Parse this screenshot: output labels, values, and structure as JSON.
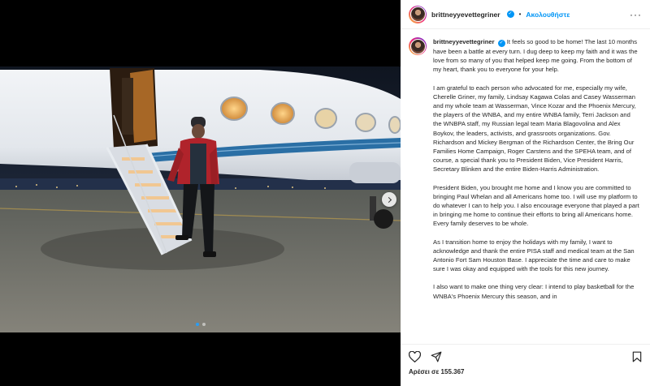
{
  "header": {
    "username": "brittneyyevettegriner",
    "separator": "•",
    "follow_label": "Ακολουθήστε",
    "more_label": "···",
    "verified_glyph": "✓"
  },
  "caption": {
    "username": "brittneyyevettegriner",
    "paragraphs": [
      "It feels so good to be home! The last 10 months have been a battle at every turn. I dug deep to keep my faith and it was the love from so many of you that helped keep me going. From the bottom of my heart, thank you to everyone for your help.",
      "I am grateful to each person who advocated for me, especially my wife, Cherelle Griner, my family, Lindsay Kagawa Colas and Casey Wasserman and my whole team at Wasserman, Vince Kozar and the Phoenix Mercury, the players of the WNBA, and my entire WNBA family, Terri Jackson and the WNBPA staff, my Russian legal team Maria Blagovolina and Alex Boykov, the leaders, activists, and grassroots organizations. Gov. Richardson and Mickey Bergman of the Richardson Center, the Bring Our Families Home Campaign, Roger Carstens and the SPEHA team, and of course, a special thank you to President Biden, Vice President Harris, Secretary Blinken and the entire Biden-Harris Administration.",
      "President Biden, you brought me home and I know you are committed to bringing Paul Whelan and all Americans home too. I will use my platform to do whatever I can to help you. I also encourage everyone that played a part in bringing me home to continue their efforts to bring all Americans home. Every family deserves to be whole.",
      "As I transition home to enjoy the holidays with my family, I want to acknowledge and thank the entire PISA staff and medical team at the San Antonio Fort Sam Houston Base. I appreciate the time and care to make sure I was okay and equipped with the tools for this new journey.",
      "I also want to make one thing very clear: I intend to play basketball for the WNBA's Phoenix Mercury this season, and in"
    ]
  },
  "actions": {
    "like_icon": "heart-icon",
    "share_icon": "share-icon",
    "save_icon": "bookmark-icon"
  },
  "likes_text": "Αρέσει σε 155.367",
  "carousel": {
    "slide_count": 2,
    "active_index": 0
  },
  "colors": {
    "link": "#0095f6",
    "active_dot": "#2a9df4"
  }
}
